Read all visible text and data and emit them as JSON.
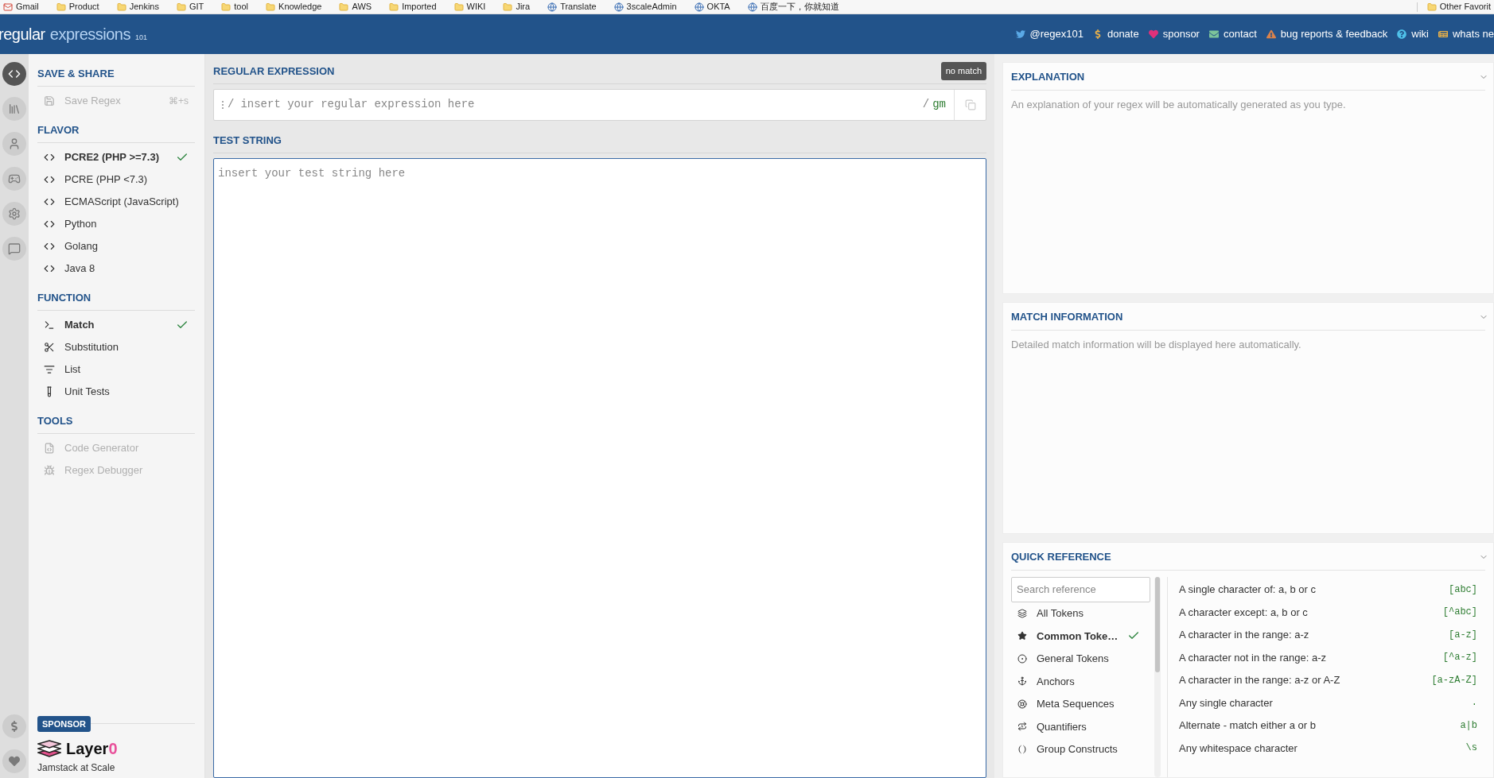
{
  "bookmarks": [
    {
      "label": "Gmail",
      "kind": "mail"
    },
    {
      "label": "Product",
      "kind": "folder"
    },
    {
      "label": "Jenkins",
      "kind": "folder"
    },
    {
      "label": "GIT",
      "kind": "folder"
    },
    {
      "label": "tool",
      "kind": "folder"
    },
    {
      "label": "Knowledge",
      "kind": "folder"
    },
    {
      "label": "AWS",
      "kind": "folder"
    },
    {
      "label": "Imported",
      "kind": "folder"
    },
    {
      "label": "WIKI",
      "kind": "folder"
    },
    {
      "label": "Jira",
      "kind": "folder"
    },
    {
      "label": "Translate",
      "kind": "site"
    },
    {
      "label": "3scaleAdmin",
      "kind": "site"
    },
    {
      "label": "OKTA",
      "kind": "site"
    },
    {
      "label": "百度一下，你就知道",
      "kind": "site"
    }
  ],
  "other_bookmarks": "Other Favorit",
  "header": {
    "logo_main": "regular",
    "logo_accent": "expressions",
    "logo_version": "101",
    "links": [
      {
        "kind": "twitter",
        "label": "@regex101"
      },
      {
        "kind": "donate",
        "label": "donate"
      },
      {
        "kind": "sponsor",
        "label": "sponsor"
      },
      {
        "kind": "contact",
        "label": "contact"
      },
      {
        "kind": "bug",
        "label": "bug reports & feedback"
      },
      {
        "kind": "wiki",
        "label": "wiki"
      },
      {
        "kind": "news",
        "label": "whats ne"
      }
    ]
  },
  "icon_strip": {
    "top": [
      {
        "kind": "code",
        "selected": true
      },
      {
        "kind": "library",
        "selected": false
      },
      {
        "kind": "user",
        "selected": false
      },
      {
        "kind": "game",
        "selected": false
      },
      {
        "kind": "settings",
        "selected": false
      },
      {
        "kind": "chat",
        "selected": false
      }
    ],
    "bottom": [
      {
        "kind": "dollar"
      },
      {
        "kind": "heart"
      }
    ]
  },
  "sidebar": [
    {
      "title": "SAVE & SHARE",
      "items": [
        {
          "kind": "save",
          "label": "Save Regex",
          "shortcut": "⌘+s",
          "disabled": true,
          "selected": false
        }
      ]
    },
    {
      "title": "FLAVOR",
      "items": [
        {
          "kind": "code",
          "label": "PCRE2 (PHP >=7.3)",
          "disabled": false,
          "selected": true
        },
        {
          "kind": "code",
          "label": "PCRE (PHP <7.3)",
          "disabled": false,
          "selected": false
        },
        {
          "kind": "code",
          "label": "ECMAScript (JavaScript)",
          "disabled": false,
          "selected": false
        },
        {
          "kind": "code",
          "label": "Python",
          "disabled": false,
          "selected": false
        },
        {
          "kind": "code",
          "label": "Golang",
          "disabled": false,
          "selected": false
        },
        {
          "kind": "code",
          "label": "Java 8",
          "disabled": false,
          "selected": false
        }
      ]
    },
    {
      "title": "FUNCTION",
      "items": [
        {
          "kind": "terminal",
          "label": "Match",
          "disabled": false,
          "selected": true
        },
        {
          "kind": "scissors",
          "label": "Substitution",
          "disabled": false,
          "selected": false
        },
        {
          "kind": "list",
          "label": "List",
          "disabled": false,
          "selected": false
        },
        {
          "kind": "test",
          "label": "Unit Tests",
          "disabled": false,
          "selected": false
        }
      ]
    },
    {
      "title": "TOOLS",
      "items": [
        {
          "kind": "file",
          "label": "Code Generator",
          "disabled": true,
          "selected": false
        },
        {
          "kind": "bug",
          "label": "Regex Debugger",
          "disabled": true,
          "selected": false
        }
      ]
    }
  ],
  "sponsor": {
    "badge": "SPONSOR",
    "name_main": "Layer",
    "name_accent": "0",
    "tagline": "Jamstack at Scale"
  },
  "regex": {
    "title": "REGULAR EXPRESSION",
    "status": "no match",
    "open_delimiter": "/",
    "placeholder": "insert your regular expression here",
    "close_delimiter": "/",
    "flags": "gm"
  },
  "test_string": {
    "title": "TEST STRING",
    "placeholder": "insert your test string here"
  },
  "explanation": {
    "title": "EXPLANATION",
    "text": "An explanation of your regex will be automatically generated as you type."
  },
  "match_information": {
    "title": "MATCH INFORMATION",
    "text": "Detailed match information will be displayed here automatically."
  },
  "quick_reference": {
    "title": "QUICK REFERENCE",
    "search_placeholder": "Search reference",
    "categories": [
      {
        "kind": "all",
        "label": "All Tokens",
        "selected": false
      },
      {
        "kind": "star",
        "label": "Common Toke…",
        "selected": true
      },
      {
        "kind": "general",
        "label": "General Tokens",
        "selected": false
      },
      {
        "kind": "anchor",
        "label": "Anchors",
        "selected": false
      },
      {
        "kind": "meta",
        "label": "Meta Sequences",
        "selected": false
      },
      {
        "kind": "quant",
        "label": "Quantifiers",
        "selected": false
      },
      {
        "kind": "group",
        "label": "Group Constructs",
        "selected": false
      }
    ],
    "tokens": [
      {
        "description": "A single character of: a, b or c",
        "token": "[abc]"
      },
      {
        "description": "A character except: a, b or c",
        "token": "[^abc]"
      },
      {
        "description": "A character in the range: a-z",
        "token": "[a-z]"
      },
      {
        "description": "A character not in the range: a-z",
        "token": "[^a-z]"
      },
      {
        "description": "A character in the range: a-z or A-Z",
        "token": "[a-zA-Z]"
      },
      {
        "description": "Any single character",
        "token": "."
      },
      {
        "description": "Alternate - match either a or b",
        "token": "a|b"
      },
      {
        "description": "Any whitespace character",
        "token": "\\s"
      }
    ]
  }
}
